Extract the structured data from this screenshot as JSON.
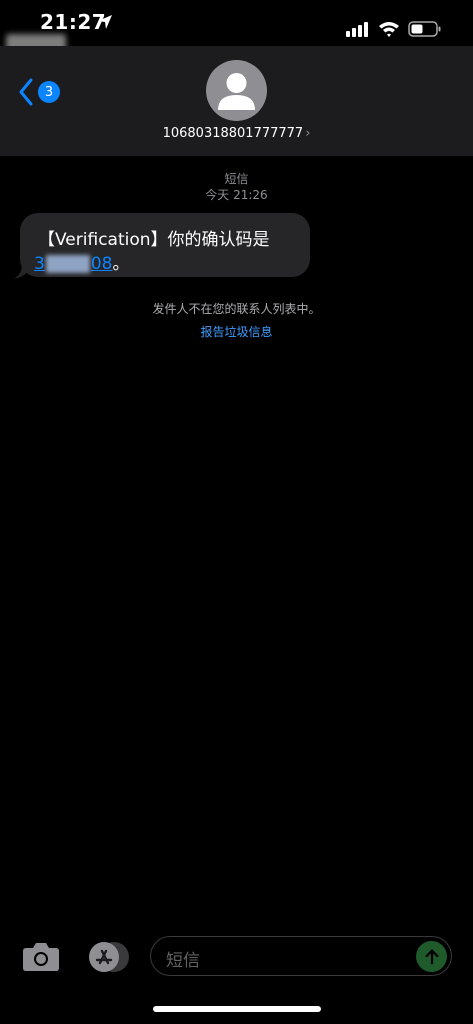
{
  "status_bar": {
    "time": "21:27",
    "icons": [
      "location-arrow-icon",
      "cellular-signal-icon",
      "wifi-icon",
      "battery-icon"
    ]
  },
  "header": {
    "back_badge_count": "3",
    "contact_name": "10680318801777777",
    "chevron": "›"
  },
  "conversation": {
    "service_label": "短信",
    "timestamp": "今天 21:26",
    "message": {
      "line1": "【Verification】你的确认码是",
      "code_start": "3",
      "code_end": "08",
      "suffix": "。"
    },
    "unknown_sender_notice": "发件人不在您的联系人列表中。",
    "report_link": "报告垃圾信息"
  },
  "composer": {
    "placeholder": "短信"
  },
  "colors": {
    "accent": "#0a84ff",
    "bubble": "#262628",
    "header_bg": "#1c1c1e",
    "send_button": "#1e5a2a"
  }
}
